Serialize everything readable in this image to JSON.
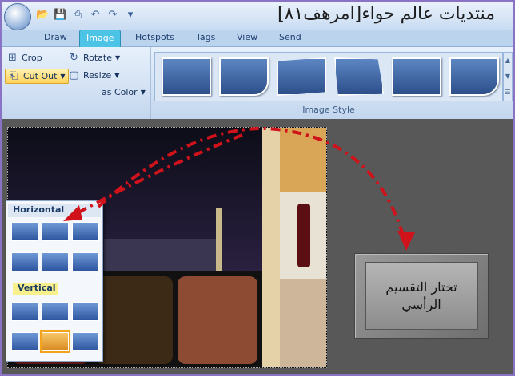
{
  "window": {
    "title": "منتديات عالم حواء[امرهف٨١]"
  },
  "qat": {
    "icons": [
      "folder-open-icon",
      "save-icon",
      "print-icon",
      "undo-icon",
      "redo-icon",
      "customize-icon"
    ]
  },
  "tabs": [
    {
      "label": "Draw"
    },
    {
      "label": "Image",
      "active": true
    },
    {
      "label": "Hotspots"
    },
    {
      "label": "Tags"
    },
    {
      "label": "View"
    },
    {
      "label": "Send"
    }
  ],
  "ribbon": {
    "crop_label": "Crop",
    "rotate_label": "Rotate",
    "cutout_label": "Cut Out",
    "resize_label": "Resize",
    "canvas_color_label": "as Color",
    "image_style_label": "Image Style"
  },
  "cutout_menu": {
    "horizontal_label": "Horizontal",
    "vertical_label": "Vertical"
  },
  "callout": {
    "text": "تختار التقسيم\nالرأسي"
  },
  "colors": {
    "accent_tab": "#4dc3e6",
    "arrow": "#d0121b",
    "selection": "#f3a21b"
  }
}
